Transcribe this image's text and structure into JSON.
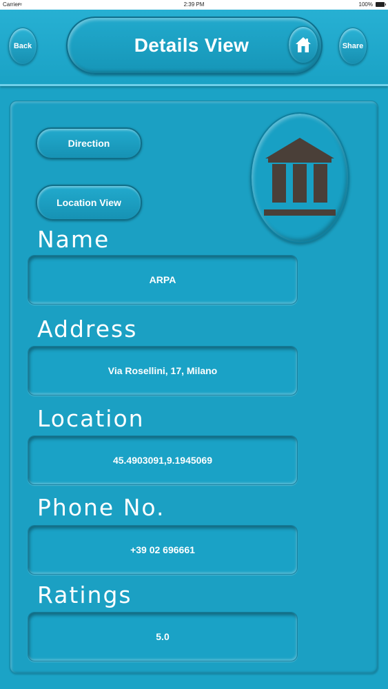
{
  "status_bar": {
    "carrier": "Carrier",
    "time": "2:39 PM",
    "battery": "100%"
  },
  "header": {
    "back_label": "Back",
    "title": "Details View",
    "share_label": "Share",
    "home_icon": "home-icon"
  },
  "actions": {
    "direction_label": "Direction",
    "location_view_label": "Location View"
  },
  "place_icon": "museum-icon",
  "fields": [
    {
      "label": "Name",
      "value": "ARPA"
    },
    {
      "label": "Address",
      "value": "Via Rosellini, 17, Milano"
    },
    {
      "label": "Location",
      "value": "45.4903091,9.1945069"
    },
    {
      "label": "Phone No.",
      "value": "+39 02 696661"
    },
    {
      "label": "Ratings",
      "value": "5.0"
    }
  ],
  "colors": {
    "background": "#1ba3c6",
    "text": "#ffffff",
    "icon": "#4a3f38"
  }
}
